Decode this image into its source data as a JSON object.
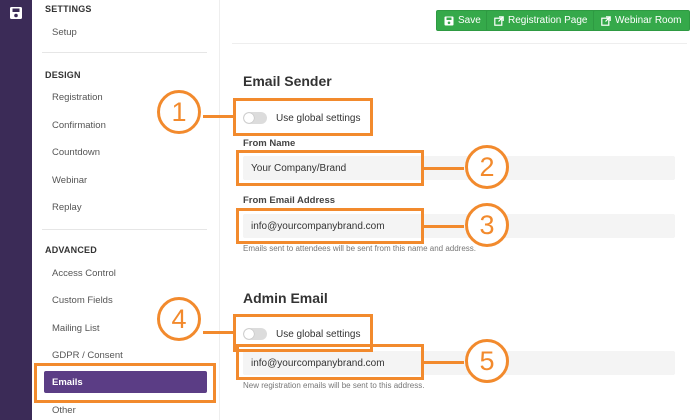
{
  "toolbar": {
    "save": "Save",
    "registration_page": "Registration Page",
    "webinar_room": "Webinar Room"
  },
  "sidebar": {
    "settings_heading": "SETTINGS",
    "setup": "Setup",
    "design_heading": "DESIGN",
    "design_items": [
      "Registration",
      "Confirmation",
      "Countdown",
      "Webinar",
      "Replay"
    ],
    "advanced_heading": "ADVANCED",
    "advanced_items": [
      "Access Control",
      "Custom Fields",
      "Mailing List",
      "GDPR / Consent"
    ],
    "active_item": "Emails",
    "other": "Other"
  },
  "email_sender": {
    "heading": "Email Sender",
    "toggle_label": "Use global settings",
    "from_name_label": "From Name",
    "from_name_value": "Your Company/Brand",
    "from_email_label": "From Email Address",
    "from_email_value": "info@yourcompanybrand.com",
    "help": "Emails sent to attendees will be sent from this name and address."
  },
  "admin_email": {
    "heading": "Admin Email",
    "toggle_label": "Use global settings",
    "email_value": "info@yourcompanybrand.com",
    "help": "New registration emails will be sent to this address."
  },
  "callouts": [
    "1",
    "2",
    "3",
    "4",
    "5"
  ],
  "colors": {
    "rail": "#3b2b57",
    "active_nav": "#5b3d85",
    "button_green": "#35a94a",
    "annotation_orange": "#f28a2d"
  }
}
